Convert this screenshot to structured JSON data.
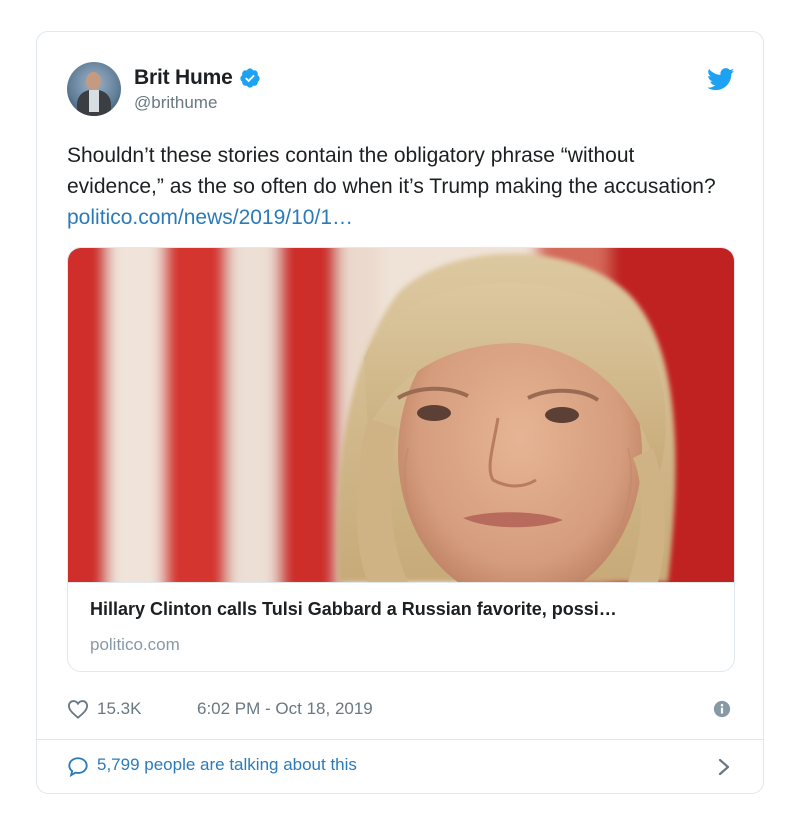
{
  "author": {
    "name": "Brit Hume",
    "handle": "@brithume"
  },
  "icons": {
    "verified": "verified-badge-icon",
    "brand": "twitter-bird-icon",
    "like": "heart-icon",
    "info": "info-icon",
    "reply": "speech-bubble-icon",
    "more": "chevron-right-icon"
  },
  "tweet": {
    "text": "Shouldn’t these stories contain the obligatory phrase “without evidence,” as the so often do when it’s Trump making the accusation? ",
    "link": "politico.com/news/2019/10/1…"
  },
  "card": {
    "title": "Hillary Clinton calls Tulsi Gabbard a Russian favorite, possi…",
    "domain": "politico.com"
  },
  "meta": {
    "likes": "15.3K",
    "timestamp": "6:02 PM - Oct 18, 2019"
  },
  "footer": {
    "talking": "5,799 people are talking about this"
  },
  "colors": {
    "link": "#2b7bb9",
    "brand": "#1da1f2",
    "muted": "#697882",
    "border": "#e1e8ed"
  }
}
